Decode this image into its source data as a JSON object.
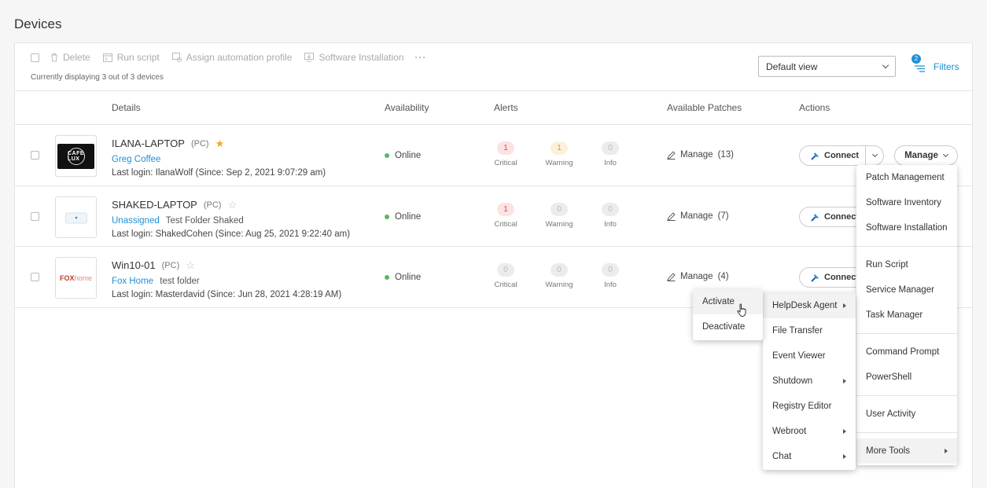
{
  "page": {
    "title": "Devices"
  },
  "toolbar": {
    "delete_label": "Delete",
    "run_script_label": "Run script",
    "assign_profile_label": "Assign automation profile",
    "software_installation_label": "Software Installation",
    "more_label": "···",
    "displaying_text": "Currently displaying 3 out of 3 devices",
    "view_selected": "Default view",
    "filters_label": "Filters",
    "filters_count": "2"
  },
  "table": {
    "headers": {
      "details": "Details",
      "availability": "Availability",
      "alerts": "Alerts",
      "patches": "Available Patches",
      "actions": "Actions"
    },
    "alert_labels": {
      "critical": "Critical",
      "warning": "Warning",
      "info": "Info"
    },
    "rows": [
      {
        "name": "ILANA-LAPTOP",
        "type": "(PC)",
        "starred": true,
        "customer": "Greg Coffee",
        "folder": "",
        "last_login": "Last login: IlanaWolf (Since: Sep 2, 2021 9:07:29 am)",
        "availability": "Online",
        "critical": "1",
        "warning": "1",
        "info": "0",
        "patches_label": "Manage",
        "patches_count": "(13)",
        "thumb_text": "CAFE LUX"
      },
      {
        "name": "SHAKED-LAPTOP",
        "type": "(PC)",
        "starred": false,
        "customer": "Unassigned",
        "folder": "Test Folder Shaked",
        "last_login": "Last login: ShakedCohen (Since: Aug 25, 2021 9:22:40 am)",
        "availability": "Online",
        "critical": "1",
        "warning": "0",
        "info": "0",
        "patches_label": "Manage",
        "patches_count": "(7)"
      },
      {
        "name": "Win10-01",
        "type": "(PC)",
        "starred": false,
        "customer": "Fox Home",
        "folder": "test folder",
        "last_login": "Last login: Masterdavid (Since: Jun 28, 2021 4:28:19 AM)",
        "availability": "Online",
        "critical": "0",
        "warning": "0",
        "info": "0",
        "patches_label": "Manage",
        "patches_count": "(4)",
        "thumb_text_a": "FOX",
        "thumb_text_b": "home"
      }
    ]
  },
  "actions": {
    "connect_label": "Connect",
    "manage_label": "Manage"
  },
  "manage_menu": {
    "items": [
      "Patch Management",
      "Software Inventory",
      "Software Installation",
      "Run Script",
      "Service Manager",
      "Task Manager",
      "Command Prompt",
      "PowerShell",
      "User Activity",
      "More Tools"
    ]
  },
  "tools_menu": {
    "items": [
      "HelpDesk Agent",
      "File Transfer",
      "Event Viewer",
      "Shutdown",
      "Registry Editor",
      "Webroot",
      "Chat"
    ]
  },
  "helpdesk_menu": {
    "items": [
      "Activate",
      "Deactivate"
    ]
  },
  "colors": {
    "accent": "#1f8fd6",
    "online": "#5cb85c",
    "critical": "#d9534f",
    "warning": "#e09b25",
    "star": "#f5a623"
  }
}
